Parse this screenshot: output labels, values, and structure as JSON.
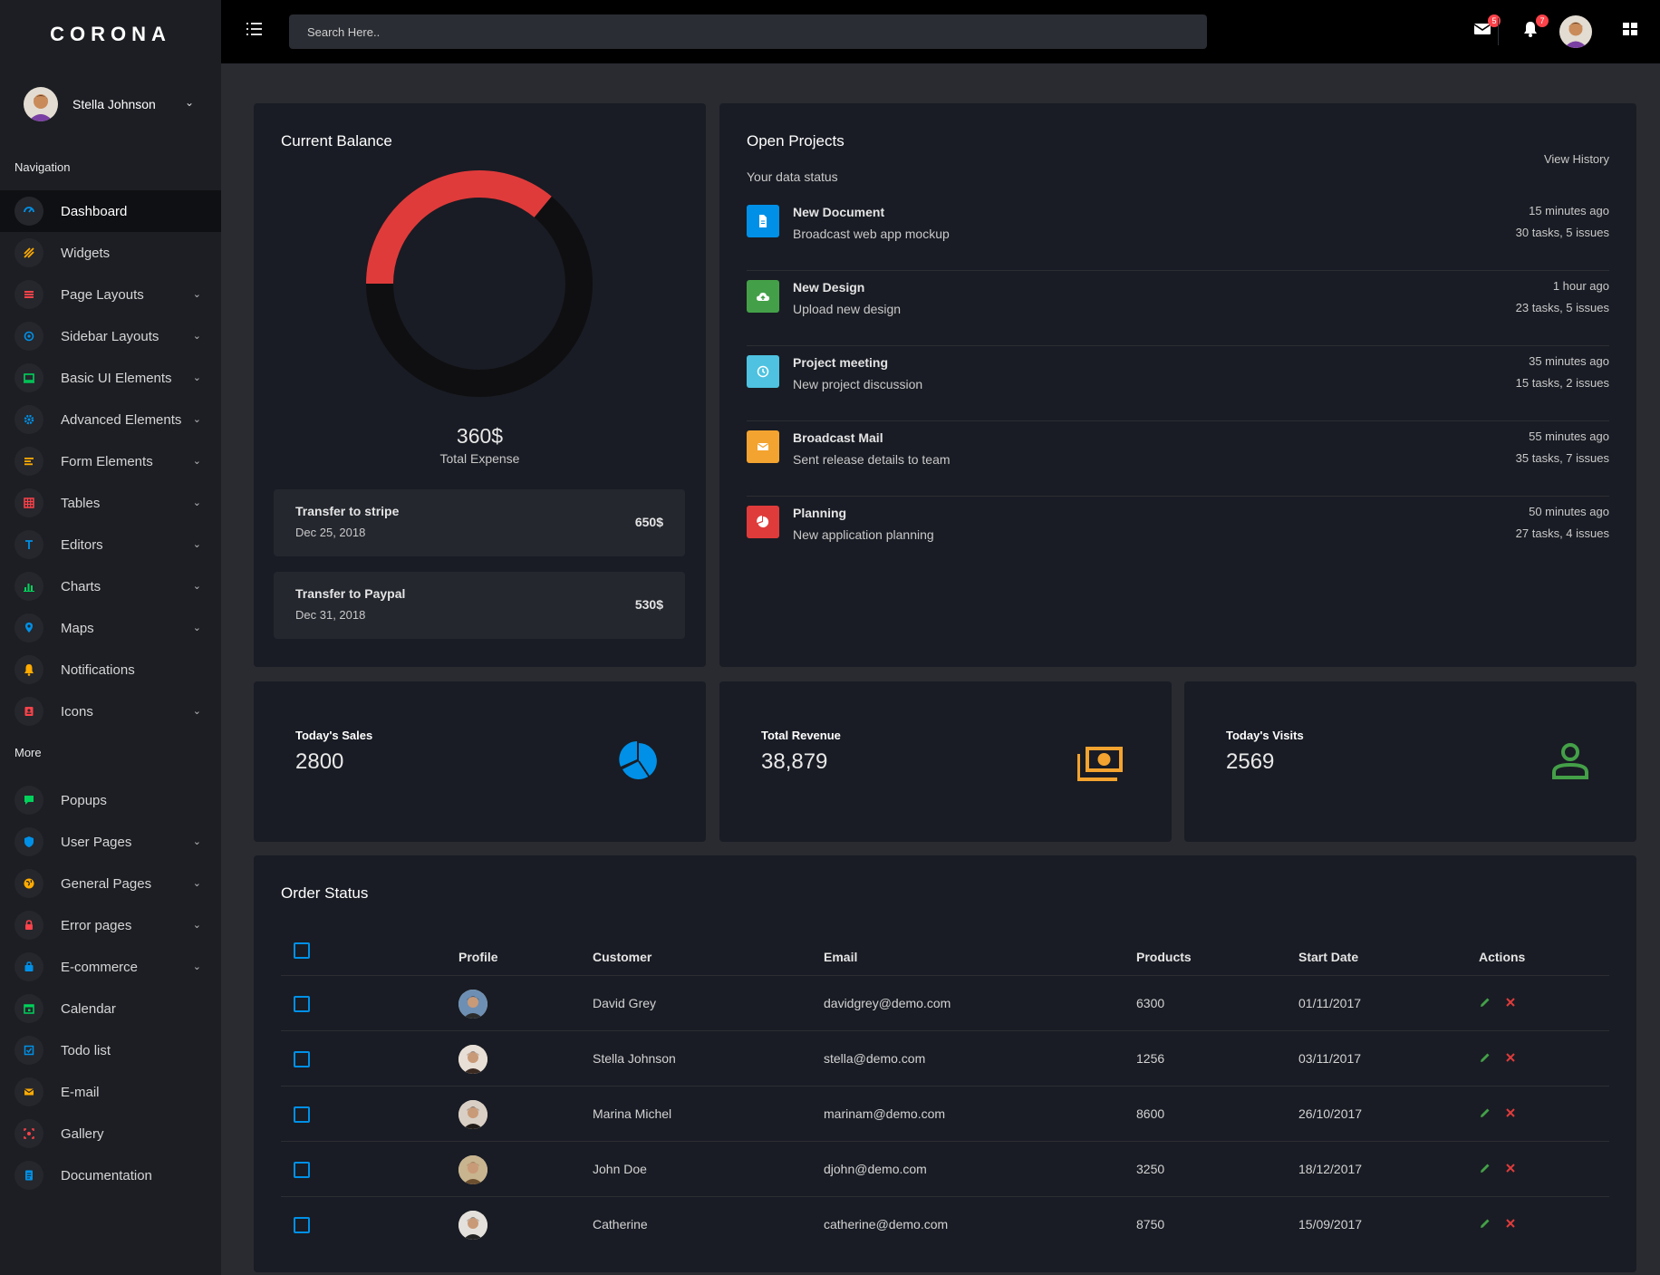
{
  "brand": "CORONA",
  "sidebar": {
    "user_name": "Stella Johnson",
    "nav_title": "Navigation",
    "more_title": "More",
    "items": [
      {
        "label": "Dashboard",
        "icon": "speedometer-icon",
        "color": "#0090e7",
        "active": true,
        "expand": false
      },
      {
        "label": "Widgets",
        "icon": "widgets-icon",
        "color": "#ffab00",
        "expand": false
      },
      {
        "label": "Page Layouts",
        "icon": "layers-icon",
        "color": "#fc424a",
        "expand": true
      },
      {
        "label": "Sidebar Layouts",
        "icon": "crosshair-icon",
        "color": "#0090e7",
        "expand": true
      },
      {
        "label": "Basic UI Elements",
        "icon": "laptop-icon",
        "color": "#00d25b",
        "expand": true
      },
      {
        "label": "Advanced Elements",
        "icon": "gear-icon",
        "color": "#0090e7",
        "expand": true
      },
      {
        "label": "Form Elements",
        "icon": "form-icon",
        "color": "#ffab00",
        "expand": true
      },
      {
        "label": "Tables",
        "icon": "table-icon",
        "color": "#fc424a",
        "expand": true
      },
      {
        "label": "Editors",
        "icon": "text-editor-icon",
        "color": "#0090e7",
        "expand": true
      },
      {
        "label": "Charts",
        "icon": "chart-icon",
        "color": "#00d25b",
        "expand": true
      },
      {
        "label": "Maps",
        "icon": "map-marker-icon",
        "color": "#0090e7",
        "expand": true
      },
      {
        "label": "Notifications",
        "icon": "bell-icon",
        "color": "#ffab00",
        "expand": false
      },
      {
        "label": "Icons",
        "icon": "contacts-icon",
        "color": "#fc424a",
        "expand": true
      }
    ],
    "more_items": [
      {
        "label": "Popups",
        "icon": "message-icon",
        "color": "#00d25b",
        "expand": false
      },
      {
        "label": "User Pages",
        "icon": "security-icon",
        "color": "#0090e7",
        "expand": true
      },
      {
        "label": "General Pages",
        "icon": "earth-icon",
        "color": "#ffab00",
        "expand": true
      },
      {
        "label": "Error pages",
        "icon": "lock-icon",
        "color": "#fc424a",
        "expand": true
      },
      {
        "label": "E-commerce",
        "icon": "shopping-bag-icon",
        "color": "#0090e7",
        "expand": true
      },
      {
        "label": "Calendar",
        "icon": "calendar-icon",
        "color": "#00d25b",
        "expand": false
      },
      {
        "label": "Todo list",
        "icon": "todo-icon",
        "color": "#0090e7",
        "expand": false
      },
      {
        "label": "E-mail",
        "icon": "email-icon",
        "color": "#ffab00",
        "expand": false
      },
      {
        "label": "Gallery",
        "icon": "image-icon",
        "color": "#fc424a",
        "expand": false
      },
      {
        "label": "Documentation",
        "icon": "document-icon",
        "color": "#0090e7",
        "expand": false
      }
    ]
  },
  "topbar": {
    "search_placeholder": "Search Here..",
    "mail_badge": "5",
    "bell_badge": "7"
  },
  "balance": {
    "title": "Current Balance",
    "amount": "360$",
    "label": "Total Expense",
    "spent_fraction": 0.36,
    "accent": "#e03b3b",
    "transfers": [
      {
        "title": "Transfer to stripe",
        "date": "Dec 25, 2018",
        "amount": "650$"
      },
      {
        "title": "Transfer to Paypal",
        "date": "Dec 31, 2018",
        "amount": "530$"
      }
    ]
  },
  "projects": {
    "title": "Open Projects",
    "subtitle": "Your data status",
    "view_history": "View History",
    "items": [
      {
        "title": "New Document",
        "sub": "Broadcast web app mockup",
        "time": "15 minutes ago",
        "tasks": "30 tasks, 5 issues",
        "icon": "file-icon",
        "color": "#0090e7"
      },
      {
        "title": "New Design",
        "sub": "Upload new design",
        "time": "1 hour ago",
        "tasks": "23 tasks, 5 issues",
        "icon": "cloud-upload-icon",
        "color": "#44a048"
      },
      {
        "title": "Project meeting",
        "sub": "New project discussion",
        "time": "35 minutes ago",
        "tasks": "15 tasks, 2 issues",
        "icon": "clock-icon",
        "color": "#4ec2e0"
      },
      {
        "title": "Broadcast Mail",
        "sub": "Sent release details to team",
        "time": "55 minutes ago",
        "tasks": "35 tasks, 7 issues",
        "icon": "email-icon",
        "color": "#f3a32f"
      },
      {
        "title": "Planning",
        "sub": "New application planning",
        "time": "50 minutes ago",
        "tasks": "27 tasks, 4 issues",
        "icon": "pie-chart-icon",
        "color": "#e03b3b"
      }
    ]
  },
  "stats": [
    {
      "label": "Today's Sales",
      "value": "2800",
      "icon": "pie-chart-icon",
      "color": "#0090e7"
    },
    {
      "label": "Total Revenue",
      "value": "38,879",
      "icon": "cash-icon",
      "color": "#f3a32f"
    },
    {
      "label": "Today's Visits",
      "value": "2569",
      "icon": "user-icon",
      "color": "#44a048"
    }
  ],
  "orders": {
    "title": "Order Status",
    "columns": [
      "Profile",
      "Customer",
      "Email",
      "Products",
      "Start Date",
      "Actions"
    ],
    "rows": [
      {
        "customer": "David Grey",
        "email": "davidgrey@demo.com",
        "products": "6300",
        "date": "01/11/2017"
      },
      {
        "customer": "Stella Johnson",
        "email": "stella@demo.com",
        "products": "1256",
        "date": "03/11/2017"
      },
      {
        "customer": "Marina Michel",
        "email": "marinam@demo.com",
        "products": "8600",
        "date": "26/10/2017"
      },
      {
        "customer": "John Doe",
        "email": "djohn@demo.com",
        "products": "3250",
        "date": "18/12/2017"
      },
      {
        "customer": "Catherine",
        "email": "catherine@demo.com",
        "products": "8750",
        "date": "15/09/2017"
      }
    ]
  }
}
